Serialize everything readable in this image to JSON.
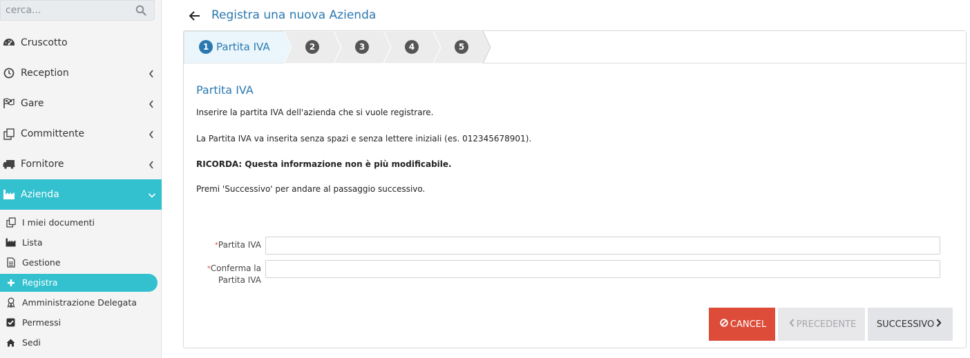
{
  "search": {
    "placeholder": "cerca..."
  },
  "sidebar": {
    "items": [
      {
        "label": "Cruscotto"
      },
      {
        "label": "Reception"
      },
      {
        "label": "Gare"
      },
      {
        "label": "Committente"
      },
      {
        "label": "Fornitore"
      },
      {
        "label": "Azienda"
      }
    ],
    "sub_items": [
      {
        "label": "I miei documenti"
      },
      {
        "label": "Lista"
      },
      {
        "label": "Gestione"
      },
      {
        "label": "Registra"
      },
      {
        "label": "Amministrazione Delegata"
      },
      {
        "label": "Permessi"
      },
      {
        "label": "Sedi"
      }
    ]
  },
  "header": {
    "title": "Registra una nuova Azienda"
  },
  "wizard": {
    "steps": [
      {
        "number": "1",
        "label": "Partita IVA"
      },
      {
        "number": "2"
      },
      {
        "number": "3"
      },
      {
        "number": "4"
      },
      {
        "number": "5"
      }
    ]
  },
  "main": {
    "section_title": "Partita IVA",
    "paragraphs": [
      "Inserire la partita IVA dell'azienda che si vuole registrare.",
      "La Partita IVA va inserita senza spazi e senza lettere iniziali (es. 012345678901).",
      "RICORDA: Questa informazione non è più modificabile.",
      "Premi 'Successivo' per andare al passaggio successivo."
    ],
    "fields": [
      {
        "label": "Partita IVA",
        "required_mark": "*",
        "value": ""
      },
      {
        "label_line1": "Conferma la",
        "label_line2": "Partita IVA",
        "required_mark": "*",
        "value": ""
      }
    ]
  },
  "actions": {
    "cancel": "CANCEL",
    "prev": "PRECEDENTE",
    "next": "SUCCESSIVO"
  },
  "colors": {
    "accent": "#33c1cf",
    "title_blue": "#2a78b0",
    "cancel_red": "#dd4b39"
  }
}
